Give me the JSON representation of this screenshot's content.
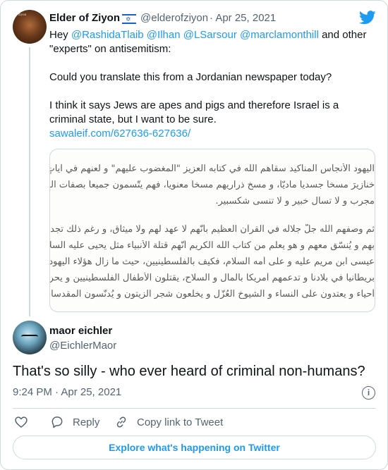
{
  "original_tweet": {
    "author_name": "Elder of Ziyon",
    "author_handle": "@elderofziyon",
    "date": "· Apr 25, 2021",
    "avatar_text": "ziyon",
    "text": {
      "hey": "Hey ",
      "mentions": [
        "@RashidaTlaib",
        "@Ilhan",
        "@LSarsour",
        "@marclamonthill"
      ],
      "after_mentions": " and other \"experts\" on antisemitism:",
      "question": "Could you translate this from a Jordanian newspaper today?",
      "body": "I think it says Jews are apes and pigs and therefore Israel is a criminal state, but I want to be sure.",
      "link": "sawaleif.com/627636-627636/"
    },
    "image_text": [
      "اليهود الأنجاس المناكيد سقاهم الله في كتابه العزيز \"المغضوب عليهم\" و لعنهم في آياتٍ كـ",
      "خنازيرَ مسخاً جسدياً ماديّاً، و مسخ ذراريهم مسخاً معنوياً، فهم يتّسمون جميعاً بصفات القر",
      "مجرب و لا تسأل خبير و لا تنسى شكسبير.",
      "ثم وصفهم الله جلّ جلاله في القرآن العظيم بأنّهم لا عهد لهم ولا ميثاق، و رغم ذلك تجد من",
      "بهم و يُنسّق معهم و هو يعلم من كتاب الله الكريم أنّهم قتلة الأنبياء مثل يحيى عليه السلا",
      "عيسى ابن مريم عليه و على أمه السلام، فكيف بالفلسطينيين، حيث ما زال هؤلاء اليهود الـ",
      "بريطانيا في بلادنا و تدعمهم أمريكا بالمال و السلاح، يقتلون الأطفال الفلسطينيين و يحرقـ",
      "أحياء و يعتدون على النساء و الشيوخ العُزّل و يخلعون شجر الزيتون و يُدنّسون المقدسات"
    ]
  },
  "reply_tweet": {
    "author_name": "maor eichler",
    "author_handle": "@EichlerMaor",
    "text": "That's so silly - who ever heard of criminal non-humans?",
    "timestamp": "9:24 PM · Apr 25, 2021",
    "info_glyph": "i"
  },
  "actions": {
    "reply": "Reply",
    "copy_link": "Copy link to Tweet"
  },
  "explore_label": "Explore what's happening on Twitter",
  "colors": {
    "accent": "#1d9bf0",
    "text": "#0f1419",
    "secondary": "#536471",
    "border": "#cfd9de"
  },
  "icons": {
    "logo": "twitter-bird-icon",
    "flag": "israel-flag-icon",
    "like": "heart-icon",
    "reply": "speech-bubble-icon",
    "copy": "link-icon",
    "info": "info-circle-icon"
  }
}
